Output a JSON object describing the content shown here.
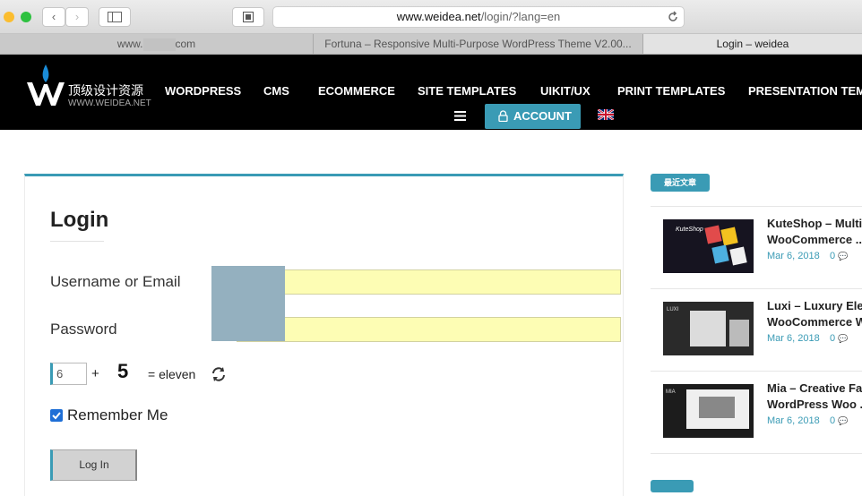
{
  "browser": {
    "url_prefix": "www.weidea.net",
    "url_suffix": "/login/?lang=en",
    "tabs": [
      {
        "prefix": "www.",
        "suffix": "com"
      },
      {
        "title": "Fortuna – Responsive Multi-Purpose WordPress Theme V2.00..."
      },
      {
        "title": "Login – weidea"
      }
    ]
  },
  "site": {
    "logo_cn": "顶级设计资源",
    "logo_sub": "WWW.WEIDEA.NET",
    "nav": [
      "WORDPRESS",
      "CMS",
      "ECOMMERCE",
      "SITE TEMPLATES",
      "UIKIT/UX",
      "PRINT TEMPLATES",
      "PRESENTATION TEMP"
    ],
    "account_label": "ACCOUNT"
  },
  "login": {
    "title": "Login",
    "username_label": "Username or Email",
    "password_label": "Password",
    "captcha_input": "6",
    "captcha_plus": "+",
    "captcha_number": "5",
    "captcha_equals": "= eleven",
    "remember_label": "Remember Me",
    "submit_label": "Log In"
  },
  "sidebar": {
    "badge": "最近文章",
    "posts": [
      {
        "title1": "KuteShop – Multip",
        "title2": "WooCommerce ..",
        "date": "Mar 6, 2018",
        "comments": "0"
      },
      {
        "title1": "Luxi – Luxury Eleg",
        "title2": "WooCommerce Wo",
        "date": "Mar 6, 2018",
        "comments": "0"
      },
      {
        "title1": "Mia – Creative Fas",
        "title2": "WordPress Woo ..",
        "date": "Mar 6, 2018",
        "comments": "0"
      }
    ],
    "thumb_labels": [
      "KuteShop",
      "LUXI",
      "MIA"
    ]
  },
  "colors": {
    "accent": "#3a9bb5",
    "nav_bg": "#000000",
    "field_bg": "#fdfdb4",
    "redact": "#94b0bf"
  }
}
